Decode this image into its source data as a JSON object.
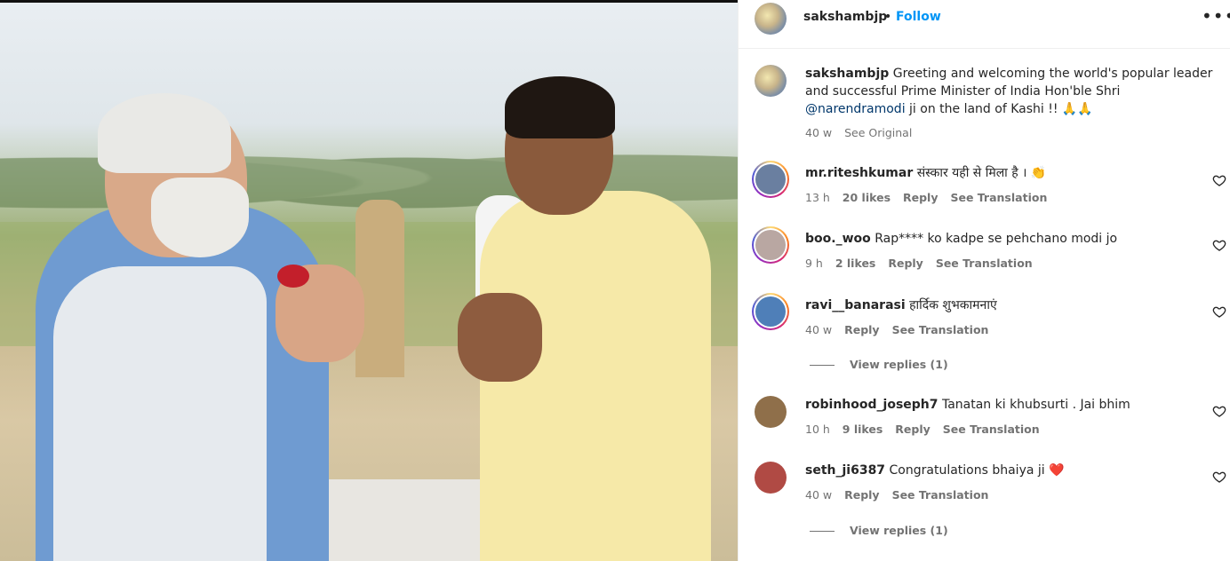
{
  "post": {
    "username": "sakshambjp",
    "dot": "•",
    "follow_label": "Follow",
    "more_label": "•••",
    "caption": {
      "username": "sakshambjp",
      "text_1": "Greeting and welcoming the world's popular leader",
      "text_2": "and successful Prime Minister of India Hon'ble Shri",
      "mention": "@narendramodi",
      "text_3": "ji on the land of Kashi !! 🙏🙏",
      "time": "40 w",
      "see_original": "See Original"
    }
  },
  "comments": [
    {
      "username": "mr.riteshkumar",
      "text": "संस्कार यही से मिला है । 👏",
      "time": "13 h",
      "likes": "20 likes",
      "reply": "Reply",
      "see_translation": "See Translation",
      "avatar_color": "#6a7fa0",
      "story_ring": true
    },
    {
      "username": "boo._woo",
      "text": "Rap**** ko kadpe se pehchano modi jo",
      "time": "9 h",
      "likes": "2 likes",
      "reply": "Reply",
      "see_translation": "See Translation",
      "avatar_color": "#b9a7a2",
      "story_ring": true
    },
    {
      "username": "ravi__banarasi",
      "text": "हार्दिक शुभकामनाएं",
      "time": "40 w",
      "likes": "",
      "reply": "Reply",
      "see_translation": "See Translation",
      "view_replies": "View replies (1)",
      "avatar_color": "#4f7fb8",
      "story_ring": true
    },
    {
      "username": "robinhood_joseph7",
      "text": "Tanatan ki khubsurti . Jai bhim",
      "time": "10 h",
      "likes": "9 likes",
      "reply": "Reply",
      "see_translation": "See Translation",
      "avatar_color": "#8f6f4a",
      "story_ring": false
    },
    {
      "username": "seth_ji6387",
      "text": "Congratulations bhaiya ji ❤️",
      "time": "40 w",
      "likes": "",
      "reply": "Reply",
      "see_translation": "See Translation",
      "view_replies": "View replies (1)",
      "avatar_color": "#b04a44",
      "story_ring": false
    }
  ]
}
